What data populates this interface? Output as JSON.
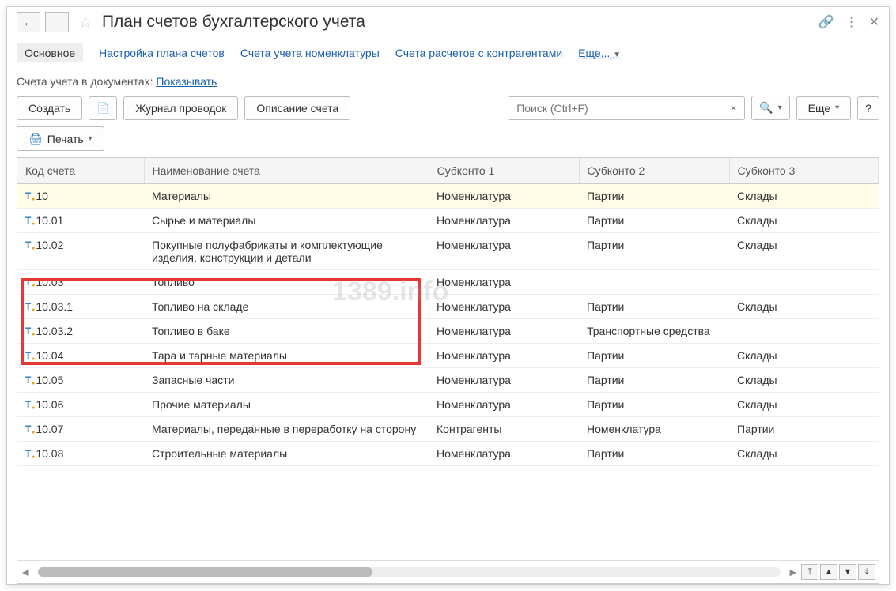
{
  "titlebar": {
    "title": "План счетов бухгалтерского учета"
  },
  "tabs": {
    "main": "Основное",
    "settings": "Настройка плана счетов",
    "nomenclature": "Счета учета номенклатуры",
    "contractors": "Счета расчетов с контрагентами",
    "more": "Еще..."
  },
  "filter": {
    "label": "Счета учета в документах:",
    "link": "Показывать"
  },
  "toolbar": {
    "create": "Создать",
    "journal": "Журнал проводок",
    "description": "Описание счета",
    "search_placeholder": "Поиск (Ctrl+F)",
    "more": "Еще",
    "print": "Печать"
  },
  "table": {
    "headers": {
      "code": "Код счета",
      "name": "Наименование счета",
      "sub1": "Субконто 1",
      "sub2": "Субконто 2",
      "sub3": "Субконто 3"
    },
    "rows": [
      {
        "code": "10",
        "name": "Материалы",
        "sub1": "Номенклатура",
        "sub2": "Партии",
        "sub3": "Склады",
        "hl": true
      },
      {
        "code": "10.01",
        "name": "Сырье и материалы",
        "sub1": "Номенклатура",
        "sub2": "Партии",
        "sub3": "Склады"
      },
      {
        "code": "10.02",
        "name": "Покупные полуфабрикаты и комплектующие изделия, конструкции и детали",
        "sub1": "Номенклатура",
        "sub2": "Партии",
        "sub3": "Склады"
      },
      {
        "code": "10.03",
        "name": "Топливо",
        "sub1": "Номенклатура",
        "sub2": "",
        "sub3": ""
      },
      {
        "code": "10.03.1",
        "name": "Топливо на складе",
        "sub1": "Номенклатура",
        "sub2": "Партии",
        "sub3": "Склады"
      },
      {
        "code": "10.03.2",
        "name": "Топливо в баке",
        "sub1": "Номенклатура",
        "sub2": "Транспортные средства",
        "sub3": ""
      },
      {
        "code": "10.04",
        "name": "Тара и тарные материалы",
        "sub1": "Номенклатура",
        "sub2": "Партии",
        "sub3": "Склады"
      },
      {
        "code": "10.05",
        "name": "Запасные части",
        "sub1": "Номенклатура",
        "sub2": "Партии",
        "sub3": "Склады"
      },
      {
        "code": "10.06",
        "name": "Прочие материалы",
        "sub1": "Номенклатура",
        "sub2": "Партии",
        "sub3": "Склады"
      },
      {
        "code": "10.07",
        "name": "Материалы, переданные в переработку на сторону",
        "sub1": "Контрагенты",
        "sub2": "Номенклатура",
        "sub3": "Партии"
      },
      {
        "code": "10.08",
        "name": "Строительные материалы",
        "sub1": "Номенклатура",
        "sub2": "Партии",
        "sub3": "Склады"
      }
    ]
  },
  "watermark": "1389.info"
}
